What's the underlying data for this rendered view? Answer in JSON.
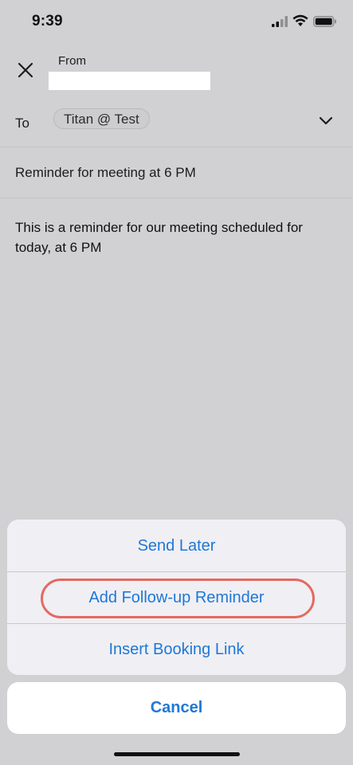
{
  "status_bar": {
    "time": "9:39",
    "signal_icon": "cellular-signal-icon",
    "wifi_icon": "wifi-icon",
    "battery_icon": "battery-icon"
  },
  "compose": {
    "close_icon": "close-icon",
    "from_label": "From",
    "from_value": "",
    "to_label": "To",
    "recipients": [
      "Titan @ Test"
    ],
    "expand_icon": "chevron-down-icon",
    "subject": "Reminder for meeting at 6 PM",
    "body": "This is a reminder for our meeting scheduled for today, at 6 PM"
  },
  "action_sheet": {
    "options": [
      {
        "label": "Send Later"
      },
      {
        "label": "Add Follow-up Reminder",
        "highlighted": true
      },
      {
        "label": "Insert Booking Link"
      }
    ],
    "cancel_label": "Cancel"
  },
  "colors": {
    "accent": "#1e78d6",
    "highlight_ring": "#e36a5f",
    "dimmed_background": "#d1d1d3",
    "sheet_background": "#f0eff4"
  }
}
